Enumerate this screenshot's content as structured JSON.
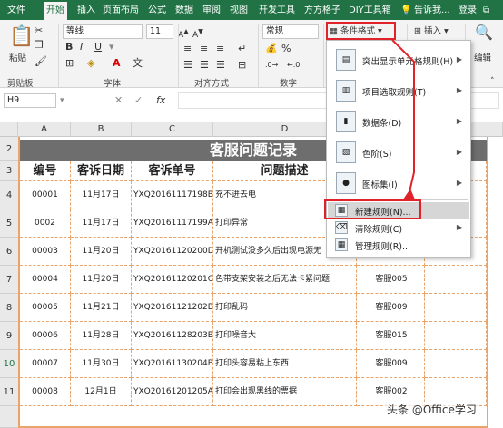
{
  "tabs": [
    "文件",
    "开始",
    "插入",
    "页面布局",
    "公式",
    "数据",
    "审阅",
    "视图",
    "开发工具",
    "方方格子",
    "DIY工具箱"
  ],
  "active_tab": "开始",
  "tell_me": "告诉我...",
  "login": "登录",
  "ribbon": {
    "paste": "粘贴",
    "clipboard": "剪贴板",
    "font_name": "等线",
    "font_size": "11",
    "font_group": "字体",
    "align_group": "对齐方式",
    "number_format": "常规",
    "number_group": "数字",
    "cond_format": "条件格式",
    "insert": "插入",
    "editing": "编辑",
    "bold": "B",
    "italic": "I",
    "underline": "U",
    "font_color_letter": "A",
    "wen": "文",
    "percent": "%"
  },
  "formula_bar": {
    "name_box": "H9",
    "fx": "fx"
  },
  "columns": [
    "A",
    "B",
    "C",
    "D"
  ],
  "rows": [
    "1",
    "2",
    "3",
    "4",
    "5",
    "6",
    "7",
    "8",
    "9",
    "10",
    "11"
  ],
  "sheet": {
    "title": "客服问题记录",
    "headers": [
      "编号",
      "客诉日期",
      "客诉单号",
      "问题描述"
    ],
    "records": [
      {
        "id": "00001",
        "date": "11月17日",
        "order": "YXQ20161117198BB",
        "desc": "充不进去电",
        "agent": ""
      },
      {
        "id": "0002",
        "date": "11月17日",
        "order": "YXQ20161117199AC",
        "desc": "打印异常",
        "agent": ""
      },
      {
        "id": "00003",
        "date": "11月20日",
        "order": "YXQ20161120200DH",
        "desc": "开机测试没多久后出现电源无",
        "agent": ""
      },
      {
        "id": "00004",
        "date": "11月20日",
        "order": "YXQ20161120201CS",
        "desc": "色带支架安装之后无法卡紧问题",
        "agent": "客服005"
      },
      {
        "id": "00005",
        "date": "11月21日",
        "order": "YXQ20161121202BR",
        "desc": "打印乱码",
        "agent": "客服009"
      },
      {
        "id": "00006",
        "date": "11月28日",
        "order": "YXQ20161128203BF",
        "desc": "打印噪音大",
        "agent": "客服015"
      },
      {
        "id": "00007",
        "date": "11月30日",
        "order": "YXQ20161130204BM",
        "desc": "打印头容易粘上东西",
        "agent": "客服009"
      },
      {
        "id": "00008",
        "date": "12月1日",
        "order": "YXQ20161201205AC",
        "desc": "打印会出现黑线的票据",
        "agent": "客服002"
      }
    ]
  },
  "menu": {
    "items": [
      {
        "label": "突出显示单元格规则(H)",
        "icon": "highlight-rules-icon",
        "submenu": true
      },
      {
        "label": "项目选取规则(T)",
        "icon": "top-bottom-rules-icon",
        "submenu": true
      },
      {
        "label": "数据条(D)",
        "icon": "data-bars-icon",
        "submenu": true
      },
      {
        "label": "色阶(S)",
        "icon": "color-scales-icon",
        "submenu": true
      },
      {
        "label": "图标集(I)",
        "icon": "icon-sets-icon",
        "submenu": true
      },
      {
        "label": "新建规则(N)...",
        "icon": "new-rule-icon",
        "submenu": false
      },
      {
        "label": "清除规则(C)",
        "icon": "clear-rules-icon",
        "submenu": true
      },
      {
        "label": "管理规则(R)...",
        "icon": "manage-rules-icon",
        "submenu": false
      }
    ]
  },
  "watermark": "头条 @Office学习",
  "colors": {
    "excel_green": "#217346",
    "highlight_red": "#e0232a",
    "title_gray": "#6e6e6e",
    "border_orange": "#e8a46a"
  }
}
